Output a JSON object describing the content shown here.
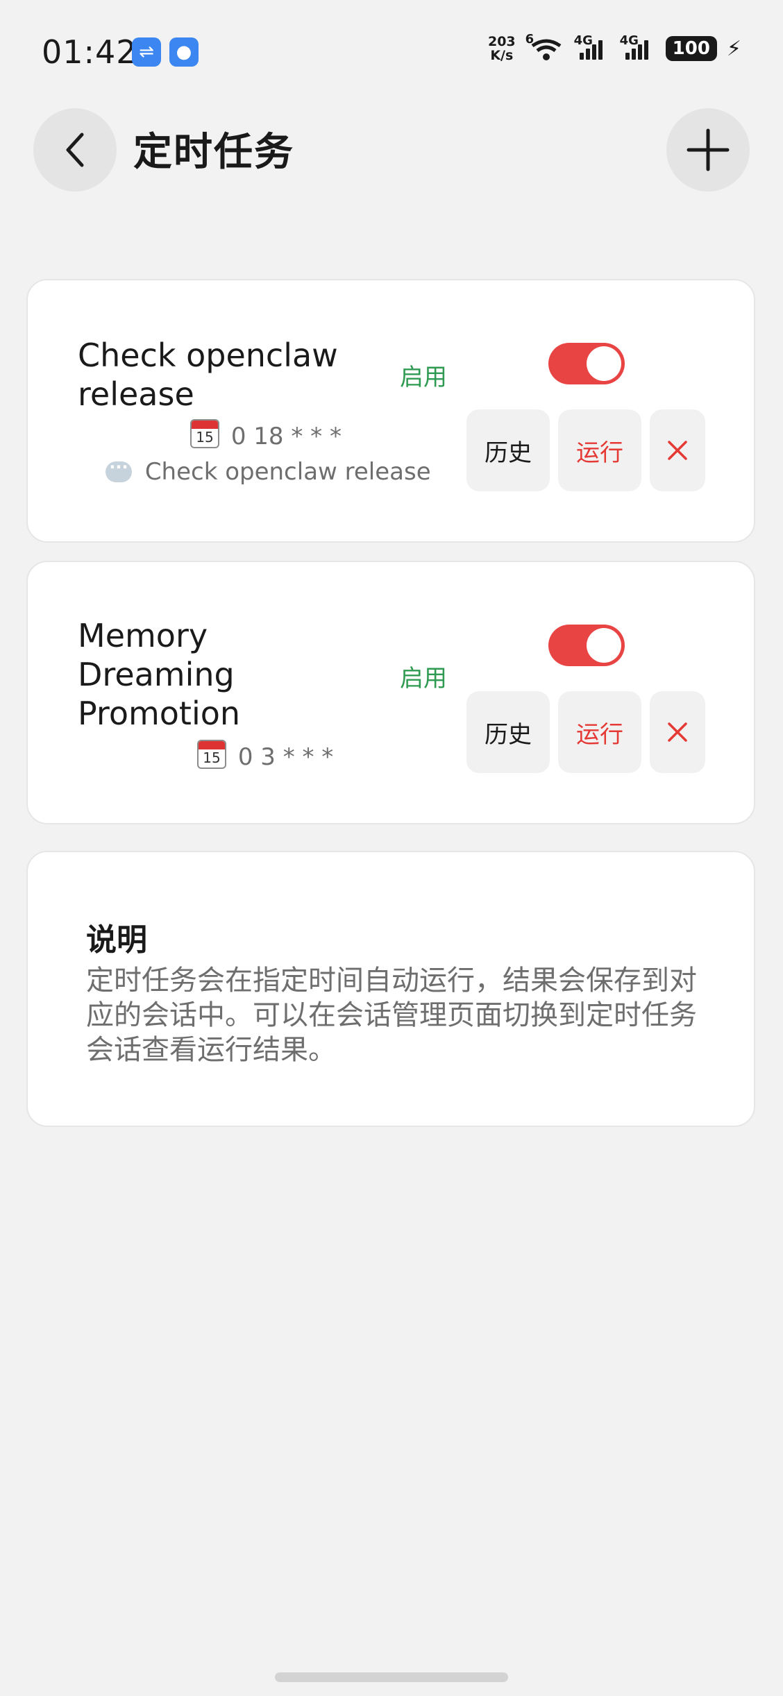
{
  "status_bar": {
    "time": "01:42",
    "speed_value": "203",
    "speed_unit": "K/s",
    "wifi_tag": "6",
    "sim1_tag": "4G",
    "sim2_tag": "4G",
    "battery": "100"
  },
  "header": {
    "title": "定时任务",
    "back_icon": "chevron-left-icon",
    "add_icon": "plus-icon"
  },
  "tasks": [
    {
      "name": "Check openclaw release",
      "status": "启用",
      "enabled": true,
      "calendar_day": "15",
      "schedule": "0 18 * * *",
      "message": "Check openclaw release",
      "history_label": "历史",
      "run_label": "运行",
      "delete_icon": "close-icon"
    },
    {
      "name": "Memory Dreaming Promotion",
      "status": "启用",
      "enabled": true,
      "calendar_day": "15",
      "schedule": "0 3 * * *",
      "history_label": "历史",
      "run_label": "运行",
      "delete_icon": "close-icon"
    }
  ],
  "note": {
    "title": "说明",
    "text": "定时任务会在指定时间自动运行，结果会保存到对应的会话中。可以在会话管理页面切换到定时任务会话查看运行结果。"
  },
  "colors": {
    "accent_red": "#e94444",
    "status_green": "#2f9a52",
    "background": "#f2f2f2"
  }
}
